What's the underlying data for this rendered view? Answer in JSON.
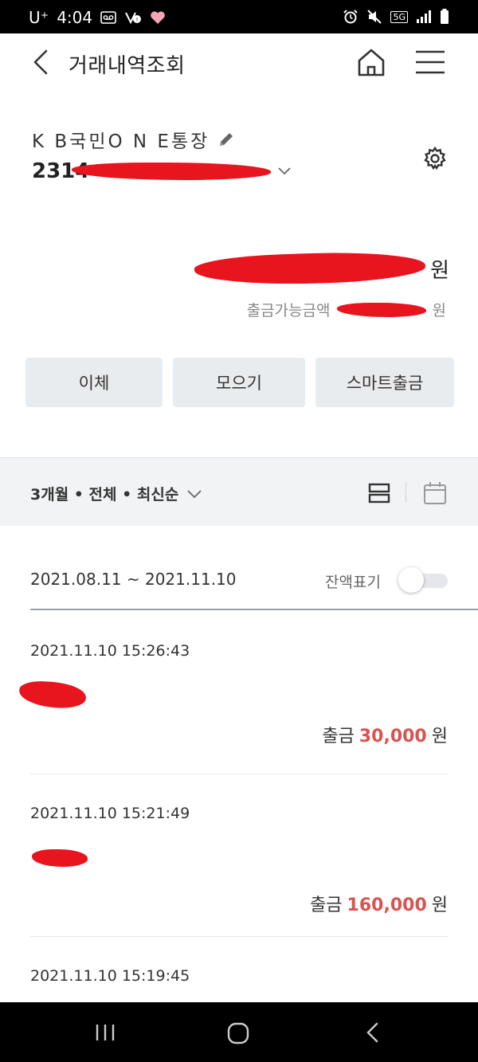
{
  "status_bar": {
    "carrier": "U⁺",
    "time": "4:04",
    "network": "5G"
  },
  "header": {
    "title": "거래내역조회"
  },
  "account": {
    "name": "K B국민O N E통장",
    "number_visible": "2314",
    "available_label": "출금가능금액",
    "currency_unit": "원"
  },
  "actions": [
    {
      "label": "이체"
    },
    {
      "label": "모으기"
    },
    {
      "label": "스마트출금"
    }
  ],
  "filter": {
    "summary": "3개월 • 전체 • 최신순"
  },
  "period": {
    "range": "2021.08.11 ~ 2021.11.10",
    "balance_toggle_label": "잔액표기",
    "balance_toggle_on": false
  },
  "transactions": [
    {
      "datetime": "2021.11.10 15:26:43",
      "type": "출금",
      "amount": "30,000",
      "unit": "원"
    },
    {
      "datetime": "2021.11.10 15:21:49",
      "type": "출금",
      "amount": "160,000",
      "unit": "원"
    },
    {
      "datetime": "2021.11.10 15:19:45"
    }
  ],
  "colors": {
    "amount_out": "#d9534f",
    "button_bg": "#e9ecef",
    "filter_bg": "#f2f3f5",
    "redaction": "#e8141e"
  },
  "icons": [
    "back-icon",
    "home-icon",
    "menu-icon",
    "pencil-icon",
    "chevron-down-icon",
    "gear-icon",
    "list-view-icon",
    "calendar-icon"
  ]
}
